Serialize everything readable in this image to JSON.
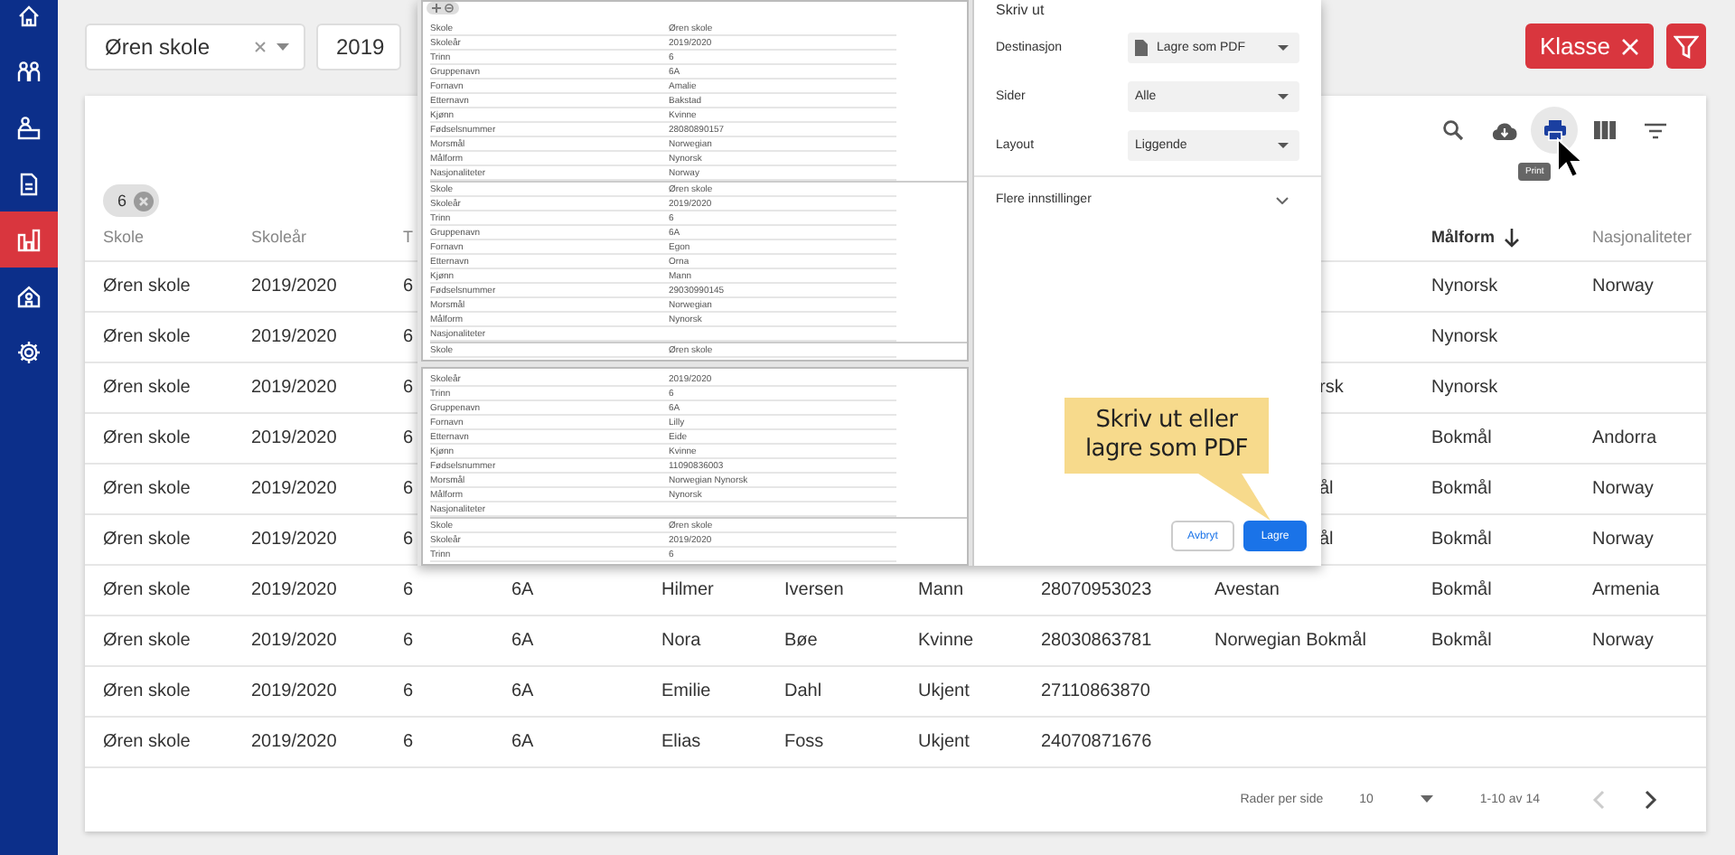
{
  "sidebar": {
    "items": [
      {
        "kind": "home",
        "selected": false
      },
      {
        "kind": "people",
        "selected": false
      },
      {
        "kind": "desk",
        "selected": false
      },
      {
        "kind": "document",
        "selected": false
      },
      {
        "kind": "chart",
        "selected": true
      },
      {
        "kind": "school",
        "selected": false
      },
      {
        "kind": "settings",
        "selected": false
      }
    ]
  },
  "filters": [
    {
      "value": "Øren skole",
      "clearable": true
    },
    {
      "value": "2019",
      "clearable": false
    }
  ],
  "header_actions": {
    "class_filter": {
      "label": "Klasse"
    }
  },
  "table": {
    "toolbar": [
      {
        "kind": "search",
        "hovered": false
      },
      {
        "kind": "download",
        "hovered": false
      },
      {
        "kind": "print",
        "hovered": true,
        "tooltip": "Print"
      },
      {
        "kind": "columns",
        "hovered": false
      },
      {
        "kind": "filter",
        "hovered": false
      }
    ],
    "chips": [
      {
        "label": "6"
      }
    ],
    "columns": [
      {
        "label": "Skole"
      },
      {
        "label": "Skoleår"
      },
      {
        "label": "T"
      },
      {},
      {},
      {},
      {},
      {},
      {},
      {
        "label": "Målform",
        "sorted": true
      },
      {
        "label": "Nasjonaliteter"
      }
    ],
    "rows": [
      {
        "cells": [
          "Øren skole",
          "2019/2020",
          "6",
          null,
          null,
          null,
          null,
          null,
          null,
          "Nynorsk",
          "Norway"
        ]
      },
      {
        "cells": [
          "Øren skole",
          "2019/2020",
          "6",
          null,
          null,
          null,
          null,
          null,
          null,
          "Nynorsk",
          null
        ]
      },
      {
        "partial_text": "rsk",
        "cells": [
          "Øren skole",
          "2019/2020",
          "6",
          null,
          null,
          null,
          null,
          null,
          null,
          "Nynorsk",
          null
        ]
      },
      {
        "cells": [
          "Øren skole",
          "2019/2020",
          "6",
          null,
          null,
          null,
          null,
          null,
          null,
          "Bokmål",
          "Andorra"
        ]
      },
      {
        "partial_text": "ål",
        "cells": [
          "Øren skole",
          "2019/2020",
          "6",
          null,
          null,
          null,
          null,
          null,
          null,
          "Bokmål",
          "Norway"
        ]
      },
      {
        "partial_text": "ål",
        "cells": [
          "Øren skole",
          "2019/2020",
          "6",
          null,
          null,
          null,
          null,
          null,
          null,
          "Bokmål",
          "Norway"
        ]
      },
      {
        "cells": [
          "Øren skole",
          "2019/2020",
          "6",
          "6A",
          "Hilmer",
          "Iversen",
          "Mann",
          "28070953023",
          "Avestan",
          "Bokmål",
          "Armenia"
        ]
      },
      {
        "cells": [
          "Øren skole",
          "2019/2020",
          "6",
          "6A",
          "Nora",
          "Bøe",
          "Kvinne",
          "28030863781",
          "Norwegian Bokmål",
          "Bokmål",
          "Norway"
        ]
      },
      {
        "cells": [
          "Øren skole",
          "2019/2020",
          "6",
          "6A",
          "Emilie",
          "Dahl",
          "Ukjent",
          "27110863870",
          null,
          null,
          null
        ]
      },
      {
        "cells": [
          "Øren skole",
          "2019/2020",
          "6",
          "6A",
          "Elias",
          "Foss",
          "Ukjent",
          "24070871676",
          null,
          null,
          null
        ]
      }
    ],
    "pagination": {
      "rows_label": "Rader per side",
      "rows_value": "10",
      "range": "1-10 av 14",
      "prev_disabled": true,
      "next_disabled": false
    }
  },
  "print_dialog": {
    "title": "Skriv ut",
    "preview": {
      "pages": [
        {
          "records": [
            {
              "fields": [
                {
                  "label": "Skole",
                  "value": "Øren skole"
                },
                {
                  "label": "Skoleår",
                  "value": "2019/2020"
                },
                {
                  "label": "Trinn",
                  "value": "6"
                },
                {
                  "label": "Gruppenavn",
                  "value": "6A"
                },
                {
                  "label": "Fornavn",
                  "value": "Amalie"
                },
                {
                  "label": "Etternavn",
                  "value": "Bakstad"
                },
                {
                  "label": "Kjønn",
                  "value": "Kvinne"
                },
                {
                  "label": "Fødselsnummer",
                  "value": "28080890157"
                },
                {
                  "label": "Morsmål",
                  "value": "Norwegian"
                },
                {
                  "label": "Målform",
                  "value": "Nynorsk"
                },
                {
                  "label": "Nasjonaliteter",
                  "value": "Norway"
                }
              ]
            },
            {
              "fields": [
                {
                  "label": "Skole",
                  "value": "Øren skole"
                },
                {
                  "label": "Skoleår",
                  "value": "2019/2020"
                },
                {
                  "label": "Trinn",
                  "value": "6"
                },
                {
                  "label": "Gruppenavn",
                  "value": "6A"
                },
                {
                  "label": "Fornavn",
                  "value": "Egon"
                },
                {
                  "label": "Etternavn",
                  "value": "Orna"
                },
                {
                  "label": "Kjønn",
                  "value": "Mann"
                },
                {
                  "label": "Fødselsnummer",
                  "value": "29030990145"
                },
                {
                  "label": "Morsmål",
                  "value": "Norwegian"
                },
                {
                  "label": "Målform",
                  "value": "Nynorsk"
                },
                {
                  "label": "Nasjonaliteter"
                }
              ]
            },
            {
              "fields": [
                {
                  "label": "Skole",
                  "value": "Øren skole"
                }
              ]
            }
          ]
        },
        {
          "records": [
            {
              "fields": [
                {
                  "label": "Skoleår",
                  "value": "2019/2020"
                },
                {
                  "label": "Trinn",
                  "value": "6"
                },
                {
                  "label": "Gruppenavn",
                  "value": "6A"
                },
                {
                  "label": "Fornavn",
                  "value": "Lilly"
                },
                {
                  "label": "Etternavn",
                  "value": "Eide"
                },
                {
                  "label": "Kjønn",
                  "value": "Kvinne"
                },
                {
                  "label": "Fødselsnummer",
                  "value": "11090836003"
                },
                {
                  "label": "Morsmål",
                  "value": "Norwegian Nynorsk"
                },
                {
                  "label": "Målform",
                  "value": "Nynorsk"
                },
                {
                  "label": "Nasjonaliteter"
                }
              ]
            },
            {
              "fields": [
                {
                  "label": "Skole",
                  "value": "Øren skole"
                },
                {
                  "label": "Skoleår",
                  "value": "2019/2020"
                },
                {
                  "label": "Trinn",
                  "value": "6"
                }
              ]
            }
          ]
        }
      ]
    },
    "settings": [
      {
        "kind": "destination",
        "label": "Destinasjon",
        "value": "Lagre som PDF"
      },
      {
        "kind": "plain",
        "label": "Sider",
        "value": "Alle"
      },
      {
        "kind": "plain",
        "label": "Layout",
        "value": "Liggende"
      }
    ],
    "more_settings": {
      "label": "Flere innstillinger",
      "expanded": false
    },
    "buttons": [
      {
        "label": "Avbryt",
        "primary": false
      },
      {
        "label": "Lagre",
        "primary": true
      }
    ],
    "callout": "Skriv ut eller lagre som PDF"
  }
}
